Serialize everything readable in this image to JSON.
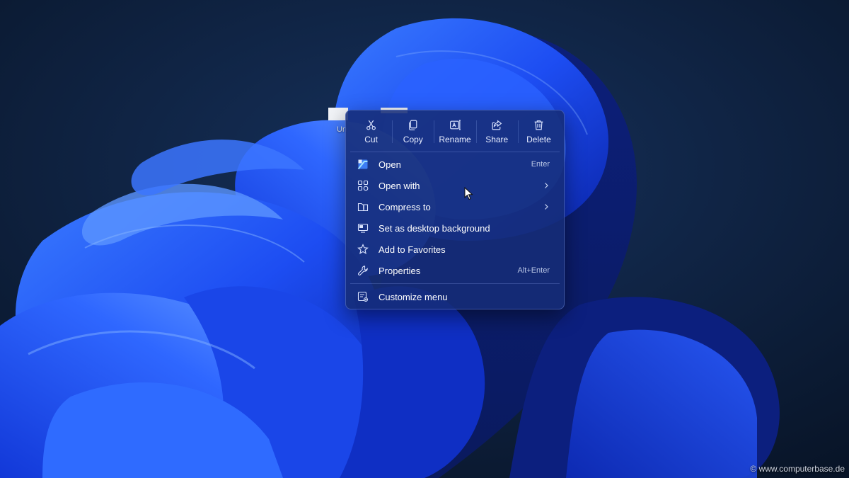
{
  "desktop": {
    "icon_label": "Un"
  },
  "quick_actions": [
    {
      "label": "Cut",
      "icon": "scissors-icon"
    },
    {
      "label": "Copy",
      "icon": "copy-icon"
    },
    {
      "label": "Rename",
      "icon": "rename-icon"
    },
    {
      "label": "Share",
      "icon": "share-icon"
    },
    {
      "label": "Delete",
      "icon": "trash-icon"
    }
  ],
  "menu_items": [
    {
      "label": "Open",
      "shortcut": "Enter",
      "icon": "open-file-icon"
    },
    {
      "label": "Open with",
      "submenu": true,
      "icon": "apps-icon"
    },
    {
      "label": "Compress to",
      "submenu": true,
      "icon": "folder-zip-icon"
    },
    {
      "label": "Set as desktop background",
      "icon": "desktop-background-icon"
    },
    {
      "label": "Add to Favorites",
      "icon": "star-icon"
    },
    {
      "label": "Properties",
      "shortcut": "Alt+Enter",
      "icon": "wrench-icon"
    }
  ],
  "footer_item": {
    "label": "Customize menu",
    "icon": "customize-menu-icon"
  },
  "watermark": "© www.computerbase.de",
  "colors": {
    "menu_bg": "#162c76",
    "wallpaper_blue": "#1f4fff",
    "background_dark": "#0b1a33"
  }
}
